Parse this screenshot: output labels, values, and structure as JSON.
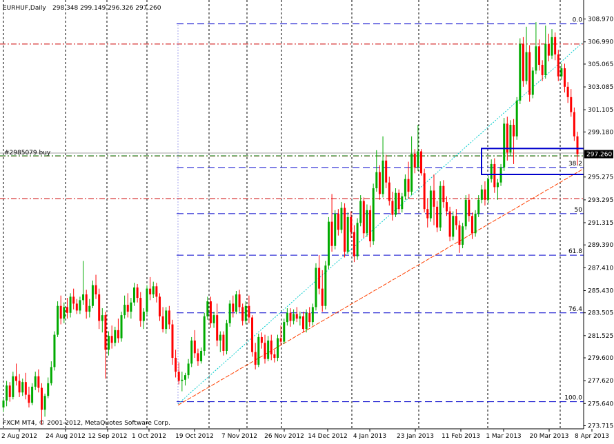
{
  "header": {
    "symbol": "EURHUF,Daily",
    "ohlc": "298.348 299.149 296.326 297.260"
  },
  "footer": {
    "copyright": "FXCM MT4, © 2001-2012, MetaQuotes Software Corp."
  },
  "order_label": "#2985079 buy",
  "colors": {
    "bull": "#00aa00",
    "bear": "#ff0000",
    "fib": "#0000cc",
    "pivot": "#cc0000",
    "trend_line": "#ff4000",
    "channel_line": "#00cccc",
    "box": "#0000cc",
    "order_line": "#a0a0a0",
    "order_level": "#007700",
    "current_price_bg": "#000000"
  },
  "chart_data": {
    "type": "candlestick",
    "title": "EURHUF,Daily",
    "ylim": [
      273.7,
      309.4
    ],
    "y_ticks": [
      308.97,
      306.99,
      305.065,
      303.085,
      301.105,
      299.18,
      297.2,
      295.275,
      293.295,
      291.315,
      289.39,
      287.41,
      285.43,
      283.505,
      281.525,
      279.6,
      277.62,
      275.64,
      273.715
    ],
    "y_tick_labels": [
      "308.970",
      "306.990",
      "305.065",
      "303.085",
      "301.105",
      "299.180",
      "297.260",
      "295.275",
      "293.295",
      "291.315",
      "289.390",
      "287.410",
      "285.430",
      "283.505",
      "281.525",
      "279.600",
      "277.620",
      "275.640",
      "273.715"
    ],
    "current_price": "297.260",
    "x_labels": [
      "2 Aug 2012",
      "24 Aug 2012",
      "12 Sep 2012",
      "1 Oct 2012",
      "19 Oct 2012",
      "7 Nov 2012",
      "26 Nov 2012",
      "14 Dec 2012",
      "4 Jan 2013",
      "23 Jan 2013",
      "11 Feb 2013",
      "1 Mar 2013",
      "20 Mar 2013",
      "8 Apr 2013"
    ],
    "grid": "vertical dashed at date labels",
    "fib_levels": [
      {
        "label": "0.0",
        "value": 308.55
      },
      {
        "label": "38.2",
        "value": 296.1
      },
      {
        "label": "50",
        "value": 292.1
      },
      {
        "label": "61.8",
        "value": 288.5
      },
      {
        "label": "76.4",
        "value": 283.5
      },
      {
        "label": "100.0",
        "value": 275.8
      }
    ],
    "pivot_levels": [
      306.8,
      297.1,
      293.4
    ],
    "order_level": 297.35,
    "trend_line": {
      "from": [
        "19 Oct 2012",
        275.5
      ],
      "to": [
        "8 Apr 2013",
        296.0
      ]
    },
    "channel_line": {
      "from": [
        "19 Oct 2012",
        275.6
      ],
      "to": [
        "8 Apr 2013",
        307.0
      ]
    },
    "zone_box": {
      "from": "1 Mar 2013",
      "top": 297.75,
      "bottom": 295.5
    },
    "candles": [
      [
        275.3,
        276.1,
        274.9,
        275.9
      ],
      [
        275.9,
        277.6,
        275.4,
        277.2
      ],
      [
        277.2,
        277.5,
        275.8,
        276.2
      ],
      [
        276.2,
        278.4,
        276,
        278
      ],
      [
        278,
        279.1,
        277.2,
        277.6
      ],
      [
        277.6,
        278.2,
        276.2,
        276.6
      ],
      [
        276.6,
        277.8,
        276.3,
        277.5
      ],
      [
        277.5,
        278.3,
        276,
        276.4
      ],
      [
        276.4,
        277.1,
        275.3,
        275.7
      ],
      [
        275.7,
        277.4,
        275.5,
        277.1
      ],
      [
        277.1,
        278.4,
        276.8,
        278
      ],
      [
        278,
        278.6,
        276.6,
        277
      ],
      [
        277,
        277.4,
        273.8,
        275.1
      ],
      [
        275.1,
        276.5,
        274.5,
        276.3
      ],
      [
        276.3,
        277.9,
        276.1,
        277.4
      ],
      [
        277.4,
        279.3,
        277.2,
        278.8
      ],
      [
        278.8,
        281.9,
        278.5,
        281.6
      ],
      [
        281.6,
        284.5,
        281.4,
        284.1
      ],
      [
        284.1,
        285,
        282.5,
        283
      ],
      [
        283,
        284.4,
        282.6,
        284
      ],
      [
        284,
        284.8,
        283,
        283.5
      ],
      [
        283.5,
        285.2,
        283.1,
        284.9
      ],
      [
        284.9,
        285.6,
        283.8,
        284.3
      ],
      [
        284.3,
        284.7,
        283.4,
        283.7
      ],
      [
        283.7,
        284.9,
        283.4,
        284.6
      ],
      [
        284.6,
        288,
        284.2,
        285.1
      ],
      [
        285.1,
        285.5,
        283,
        283.6
      ],
      [
        283.6,
        284.7,
        283.1,
        284.1
      ],
      [
        284.1,
        286.3,
        283.9,
        285.9
      ],
      [
        285.9,
        286.8,
        284.7,
        285.1
      ],
      [
        285.1,
        285.6,
        282.1,
        282.8
      ],
      [
        282.8,
        283.9,
        281.8,
        283.3
      ],
      [
        283.3,
        283.6,
        277.8,
        280.3
      ],
      [
        280.3,
        281.9,
        279.8,
        281.5
      ],
      [
        281.5,
        282.4,
        280.4,
        280.9
      ],
      [
        280.9,
        282.3,
        280.6,
        282
      ],
      [
        282,
        283,
        280.9,
        281.3
      ],
      [
        281.3,
        283.6,
        281,
        283.3
      ],
      [
        283.3,
        285,
        283,
        284.2
      ],
      [
        284.2,
        285.2,
        283.1,
        283.6
      ],
      [
        283.6,
        284.8,
        283,
        284.4
      ],
      [
        284.4,
        286.1,
        284.1,
        285.7
      ],
      [
        285.7,
        286,
        284.4,
        284.8
      ],
      [
        284.8,
        285.3,
        282.3,
        282.8
      ],
      [
        282.8,
        283.9,
        282.1,
        283.6
      ],
      [
        283.6,
        285.9,
        283.3,
        285.6
      ],
      [
        285.6,
        286.6,
        284.6,
        285.1
      ],
      [
        285.1,
        286.2,
        284.8,
        285.8
      ],
      [
        285.8,
        286.1,
        284.4,
        284.9
      ],
      [
        284.9,
        285.2,
        282.8,
        283.2
      ],
      [
        283.2,
        284,
        281.8,
        282.1
      ],
      [
        282.1,
        284,
        281.7,
        283.7
      ],
      [
        283.7,
        284.1,
        282.1,
        282.5
      ],
      [
        282.5,
        282.9,
        279,
        279.6
      ],
      [
        279.6,
        280.3,
        277.9,
        278.4
      ],
      [
        278.4,
        279.2,
        277.3,
        277.6
      ],
      [
        277.6,
        278.4,
        276.7,
        277.7
      ],
      [
        277.7,
        278.3,
        277.2,
        278.1
      ],
      [
        278.1,
        279.5,
        277.8,
        279.1
      ],
      [
        279.1,
        281.4,
        278.8,
        281.1
      ],
      [
        281.1,
        282,
        279.6,
        280
      ],
      [
        280,
        280.4,
        278.9,
        279.3
      ],
      [
        279.3,
        280.5,
        279.1,
        280.2
      ],
      [
        280.2,
        283.5,
        279.8,
        283.2
      ],
      [
        283.2,
        284.9,
        282.9,
        284.5
      ],
      [
        284.5,
        284.9,
        282.2,
        282.6
      ],
      [
        282.6,
        283.6,
        282.2,
        283.3
      ],
      [
        283.3,
        284.3,
        280.6,
        281.1
      ],
      [
        281.1,
        281.9,
        280.1,
        281.6
      ],
      [
        281.6,
        281.9,
        279.8,
        280.2
      ],
      [
        280.2,
        282.9,
        279.9,
        282.6
      ],
      [
        282.6,
        284.6,
        282.3,
        284.3
      ],
      [
        284.3,
        285,
        283.1,
        283.6
      ],
      [
        283.6,
        285.4,
        283.4,
        285.1
      ],
      [
        285.1,
        285.5,
        283.6,
        284
      ],
      [
        284,
        284.3,
        282.4,
        282.8
      ],
      [
        282.8,
        284.5,
        282.5,
        284.1
      ],
      [
        284.1,
        285,
        282.6,
        283.1
      ],
      [
        283.1,
        283.3,
        279.7,
        280.1
      ],
      [
        280.1,
        280.9,
        278.6,
        279
      ],
      [
        279,
        281.7,
        278.8,
        281.4
      ],
      [
        281.4,
        281.8,
        280.4,
        280.9
      ],
      [
        280.9,
        281.6,
        279.1,
        279.5
      ],
      [
        279.5,
        281.5,
        279.3,
        281.1
      ],
      [
        281.1,
        281.6,
        279.4,
        279.9
      ],
      [
        279.9,
        280.3,
        279.2,
        279.6
      ],
      [
        279.6,
        281.6,
        279.3,
        281.3
      ],
      [
        281.3,
        282.4,
        280.7,
        281
      ],
      [
        281,
        283,
        280.8,
        282.7
      ],
      [
        282.7,
        283.9,
        282.4,
        283.5
      ],
      [
        283.5,
        283.9,
        282.3,
        282.8
      ],
      [
        282.8,
        283.8,
        282.5,
        283.4
      ],
      [
        283.4,
        284,
        282.7,
        283
      ],
      [
        283,
        283.6,
        282.4,
        283.2
      ],
      [
        283.2,
        283.6,
        281.8,
        282.1
      ],
      [
        282.1,
        283.8,
        281.8,
        283.5
      ],
      [
        283.5,
        284,
        282.3,
        282.7
      ],
      [
        282.7,
        284.3,
        282.4,
        284
      ],
      [
        284,
        287.8,
        283.7,
        287.4
      ],
      [
        287.4,
        288.5,
        285.1,
        285.6
      ],
      [
        285.6,
        287.2,
        283.6,
        284.1
      ],
      [
        284.1,
        288,
        283.8,
        287.6
      ],
      [
        287.6,
        291.8,
        287.3,
        291.4
      ],
      [
        291.4,
        293.8,
        288.8,
        289.3
      ],
      [
        289.3,
        292.4,
        289,
        292.1
      ],
      [
        292.1,
        292.5,
        290.2,
        290.7
      ],
      [
        290.7,
        293.1,
        290.4,
        292.6
      ],
      [
        292.6,
        293,
        288.3,
        288.8
      ],
      [
        288.8,
        292.2,
        288.6,
        291.8
      ],
      [
        291.8,
        292.3,
        290,
        290.5
      ],
      [
        290.5,
        291.1,
        287.9,
        288.4
      ],
      [
        288.4,
        291.7,
        288.1,
        291.3
      ],
      [
        291.3,
        293.7,
        291,
        293.2
      ],
      [
        293.2,
        293.5,
        290,
        290.4
      ],
      [
        290.4,
        292.9,
        290.1,
        292.4
      ],
      [
        292.4,
        292.8,
        289.2,
        289.7
      ],
      [
        289.7,
        294.7,
        289.4,
        294.3
      ],
      [
        294.3,
        297.6,
        294,
        295.7
      ],
      [
        295.7,
        296.3,
        293.3,
        293.8
      ],
      [
        293.8,
        298.8,
        293.5,
        296.7
      ],
      [
        296.7,
        297.2,
        294.3,
        294.8
      ],
      [
        294.8,
        295.3,
        292.8,
        293.2
      ],
      [
        293.2,
        294,
        291.5,
        292
      ],
      [
        292,
        294.3,
        291.8,
        293.9
      ],
      [
        293.9,
        294.2,
        292.1,
        292.5
      ],
      [
        292.5,
        293.9,
        292.2,
        293.6
      ],
      [
        293.6,
        295.5,
        293.3,
        295.1
      ],
      [
        295.1,
        296.6,
        293.4,
        294
      ],
      [
        294,
        298.8,
        293.7,
        297.3
      ],
      [
        297.3,
        297.7,
        295.6,
        296.1
      ],
      [
        296.1,
        299.8,
        295.8,
        297.5
      ],
      [
        297.5,
        297.7,
        295.4,
        295.6
      ],
      [
        295.6,
        296,
        292.2,
        292.5
      ],
      [
        292.5,
        293.4,
        290.9,
        291.7
      ],
      [
        291.7,
        294.5,
        291.4,
        294.1
      ],
      [
        294.1,
        295.5,
        291.1,
        292.7
      ],
      [
        292.7,
        293.2,
        290.5,
        290.9
      ],
      [
        290.9,
        294.9,
        290.6,
        294.5
      ],
      [
        294.5,
        295,
        292.6,
        293.1
      ],
      [
        293.1,
        293.6,
        291.9,
        292.3
      ],
      [
        292.3,
        292.7,
        289.7,
        290.1
      ],
      [
        290.1,
        292.3,
        289.8,
        291.9
      ],
      [
        291.9,
        292.5,
        290.7,
        291.1
      ],
      [
        291.1,
        291.5,
        288.7,
        289.4
      ],
      [
        289.4,
        291.3,
        289.1,
        291
      ],
      [
        291,
        293.7,
        290.7,
        293.3
      ],
      [
        293.3,
        293.8,
        291.4,
        291.9
      ],
      [
        291.9,
        292.2,
        289.9,
        290.4
      ],
      [
        290.4,
        292.4,
        290.1,
        292.1
      ],
      [
        292.1,
        293.7,
        291.8,
        293.3
      ],
      [
        293.3,
        294.6,
        293,
        294.2
      ],
      [
        294.2,
        294.9,
        292.8,
        293.3
      ],
      [
        293.3,
        295.4,
        293,
        295.1
      ],
      [
        295.1,
        296.8,
        294.8,
        296.4
      ],
      [
        296.4,
        296.9,
        293.9,
        294.4
      ],
      [
        294.4,
        295.1,
        293.3,
        294.8
      ],
      [
        294.8,
        296.4,
        294.5,
        296.1
      ],
      [
        296.1,
        300.4,
        295.8,
        299.9
      ],
      [
        299.9,
        300.5,
        296.7,
        297.4
      ],
      [
        297.4,
        300.2,
        297.1,
        299.8
      ],
      [
        299.8,
        300.3,
        296.4,
        298.8
      ],
      [
        298.8,
        302.2,
        298.5,
        301.9
      ],
      [
        301.9,
        307.3,
        301.6,
        306.8
      ],
      [
        306.8,
        307.4,
        303.1,
        303.6
      ],
      [
        303.6,
        308.3,
        303.3,
        306.1
      ],
      [
        306.1,
        306.7,
        301.8,
        302.4
      ],
      [
        302.4,
        304.8,
        302.1,
        304.5
      ],
      [
        304.5,
        308.7,
        304.2,
        306.6
      ],
      [
        306.6,
        307.2,
        304.5,
        305
      ],
      [
        305,
        305.4,
        303.6,
        304.1
      ],
      [
        304.1,
        308.4,
        303.8,
        306.8
      ],
      [
        306.8,
        307.7,
        305.3,
        305.8
      ],
      [
        305.8,
        308.1,
        305.5,
        307.4
      ],
      [
        307.4,
        307.8,
        305.4,
        305.9
      ],
      [
        305.9,
        306.3,
        303.6,
        304
      ],
      [
        304,
        305.1,
        303.7,
        304.7
      ],
      [
        304.7,
        305.1,
        302.6,
        303.1
      ],
      [
        303.1,
        303.5,
        301.7,
        302.2
      ],
      [
        302.2,
        302.9,
        300.5,
        300.9
      ],
      [
        300.9,
        301.3,
        298.4,
        298.8
      ],
      [
        298.8,
        299.2,
        296.3,
        297.26
      ]
    ]
  }
}
